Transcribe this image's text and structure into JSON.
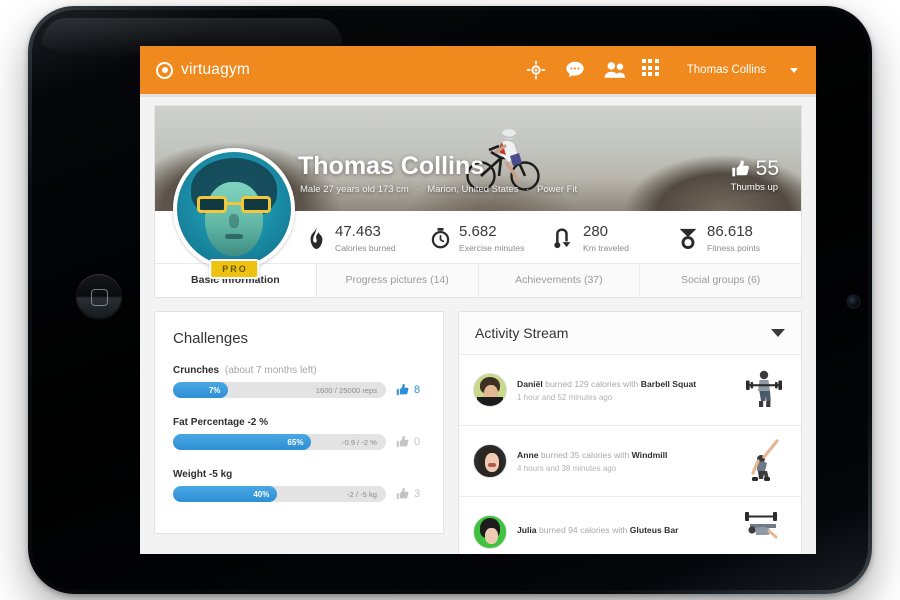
{
  "navbar": {
    "brand": "virtuagym",
    "brand_icon": "target-ring-logo-icon",
    "icons": [
      {
        "name": "crosshair-icon"
      },
      {
        "name": "chat-bubble-icon"
      },
      {
        "name": "people-icon"
      },
      {
        "name": "apps-grid-icon"
      }
    ],
    "user": "Thomas Collins",
    "bg_color": "#f08a1e"
  },
  "profile": {
    "name": "Thomas Collins",
    "meta_1": "Male 27 years old 173 cm",
    "meta_2": "Marion, United States",
    "meta_3": "Power Fit",
    "separator": "·",
    "pro_badge": "PRO",
    "thumbs_count": "55",
    "thumbs_label": "Thumbs up"
  },
  "stats": [
    {
      "icon": "flame-icon",
      "value": "47.463",
      "label": "Calories burned"
    },
    {
      "icon": "stopwatch-icon",
      "value": "5.682",
      "label": "Exercise minutes"
    },
    {
      "icon": "route-arrow-icon",
      "value": "280",
      "label": "Km traveled"
    },
    {
      "icon": "medal-icon",
      "value": "86.618",
      "label": "Fitness points"
    }
  ],
  "tabs": [
    {
      "label": "Basic information",
      "active": true
    },
    {
      "label": "Progress pictures (14)",
      "active": false
    },
    {
      "label": "Achievements (37)",
      "active": false
    },
    {
      "label": "Social groups (6)",
      "active": false
    }
  ],
  "challenges": {
    "title": "Challenges",
    "items": [
      {
        "name": "Crunches",
        "sub": "(about 7 months left)",
        "percent_label": "7%",
        "percent": 7,
        "detail": "1600 / 25000 reps",
        "likes": "8",
        "liked": true
      },
      {
        "name": "Fat Percentage  -2 %",
        "sub": "",
        "percent_label": "65%",
        "percent": 65,
        "detail": "-0.9 / -2 %",
        "likes": "0",
        "liked": false
      },
      {
        "name": "Weight -5 kg",
        "sub": "",
        "percent_label": "40%",
        "percent": 40,
        "detail": "-2 / -5 kg",
        "likes": "3",
        "liked": false
      }
    ]
  },
  "activity_stream": {
    "title": "Activity Stream",
    "collapse_icon": "chevron-down-icon",
    "items": [
      {
        "user": "Daniël",
        "middle": " burned 129 calories with ",
        "exercise": "Barbell Squat",
        "time": "1 hour and 52 minutes ago",
        "avatar_color": "#c9d98a",
        "thumb": "barbell-squat-icon"
      },
      {
        "user": "Anne",
        "middle": " burned 35 calories with ",
        "exercise": "Windmill",
        "time": "4 hours and 38 minutes ago",
        "avatar_color": "#2b2b2b",
        "thumb": "windmill-icon"
      },
      {
        "user": "Julia",
        "middle": " burned 94 calories with ",
        "exercise": "Gluteus Bar",
        "time": "",
        "avatar_color": "#3fc23f",
        "thumb": "gluteus-bar-icon"
      }
    ]
  }
}
